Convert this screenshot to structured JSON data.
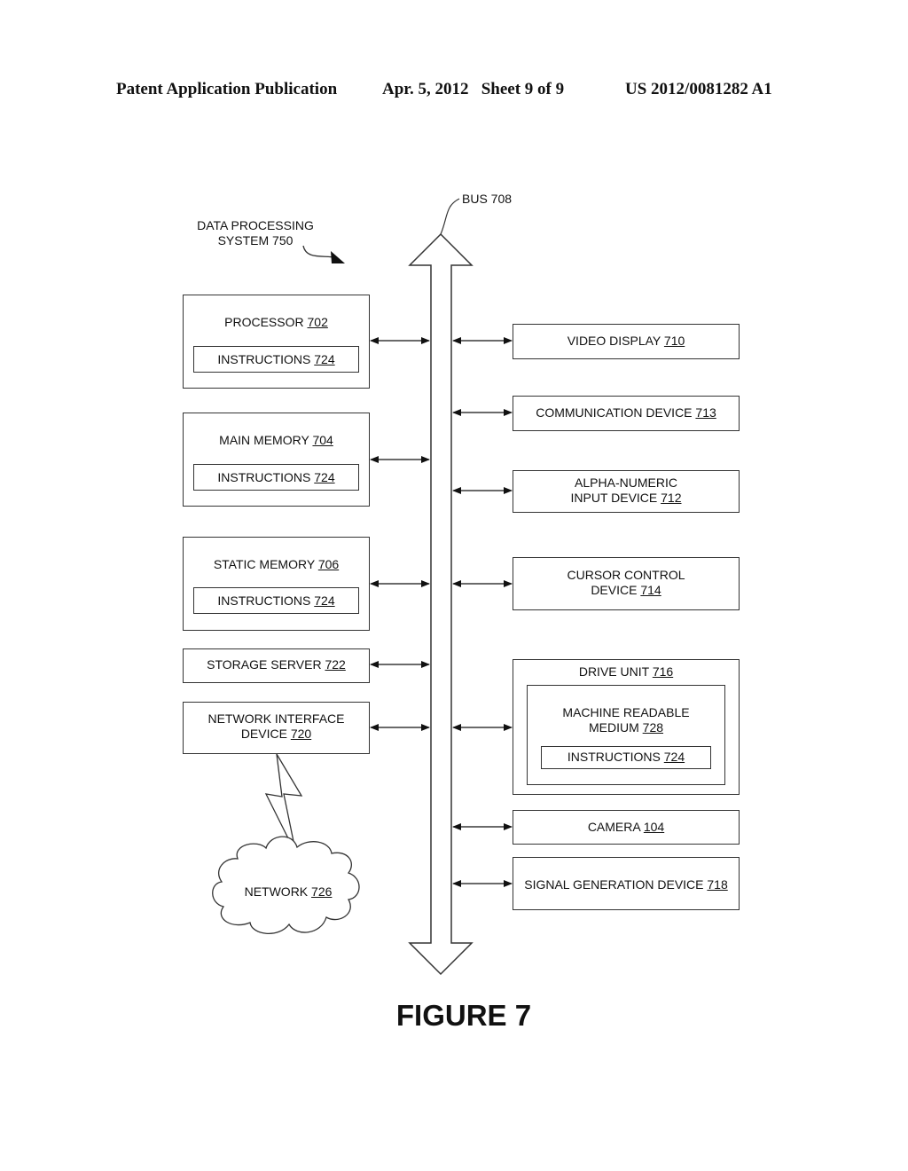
{
  "header": {
    "publication": "Patent Application Publication",
    "date_sheet": "Apr. 5, 2012   Sheet 9 of 9",
    "patent_number": "US 2012/0081282 A1"
  },
  "diagram": {
    "system_label": {
      "line1": "DATA PROCESSING",
      "line2": "SYSTEM 750"
    },
    "bus_label": "BUS 708",
    "left_blocks": {
      "processor": {
        "name": "PROCESSOR ",
        "ref": "702",
        "inner": {
          "name": "INSTRUCTIONS ",
          "ref": "724"
        }
      },
      "main_memory": {
        "name": "MAIN MEMORY ",
        "ref": "704",
        "inner": {
          "name": "INSTRUCTIONS ",
          "ref": "724"
        }
      },
      "static_memory": {
        "name": "STATIC MEMORY ",
        "ref": "706",
        "inner": {
          "name": "INSTRUCTIONS ",
          "ref": "724"
        }
      },
      "storage_server": {
        "name": "STORAGE SERVER ",
        "ref": "722"
      },
      "network_interface": {
        "line1": "NETWORK INTERFACE",
        "name": "DEVICE ",
        "ref": "720"
      }
    },
    "network": {
      "name": "NETWORK ",
      "ref": "726"
    },
    "right_blocks": {
      "video_display": {
        "name": "VIDEO DISPLAY ",
        "ref": "710"
      },
      "communication_device": {
        "name": "COMMUNICATION DEVICE ",
        "ref": "713"
      },
      "alpha_numeric": {
        "line1": "ALPHA-NUMERIC",
        "name": "INPUT DEVICE ",
        "ref": "712"
      },
      "cursor_control": {
        "line1": "CURSOR CONTROL",
        "name": "DEVICE ",
        "ref": "714"
      },
      "drive_unit": {
        "name": "DRIVE UNIT ",
        "ref": "716",
        "medium": {
          "line1": "MACHINE READABLE",
          "name": "MEDIUM ",
          "ref": "728"
        },
        "inner": {
          "name": "INSTRUCTIONS ",
          "ref": "724"
        }
      },
      "camera": {
        "name": "CAMERA ",
        "ref": "104"
      },
      "signal_generation": {
        "name": "SIGNAL GENERATION DEVICE ",
        "ref": "718"
      }
    }
  },
  "caption": "FIGURE 7"
}
